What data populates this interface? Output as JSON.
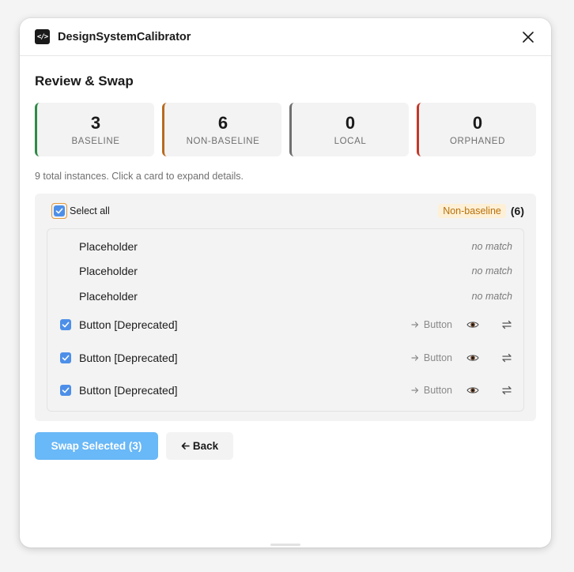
{
  "window": {
    "title": "DesignSystemCalibrator"
  },
  "heading": "Review & Swap",
  "stats": [
    {
      "count": "3",
      "label": "BASELINE",
      "color": "#2f8a46"
    },
    {
      "count": "6",
      "label": "NON-BASELINE",
      "color": "#b96a1e"
    },
    {
      "count": "0",
      "label": "LOCAL",
      "color": "#6f6f6f"
    },
    {
      "count": "0",
      "label": "ORPHANED",
      "color": "#c0392b"
    }
  ],
  "hint": "9 total instances. Click a card to expand details.",
  "group": {
    "select_all_label": "Select all",
    "select_all_checked": true,
    "tag": "Non-baseline",
    "count": "(6)",
    "rows": [
      {
        "name": "Placeholder",
        "status": "no match"
      },
      {
        "name": "Placeholder",
        "status": "no match"
      },
      {
        "name": "Placeholder",
        "status": "no match"
      },
      {
        "name": "Button [Deprecated]",
        "target": "Button",
        "checked": true
      },
      {
        "name": "Button [Deprecated]",
        "target": "Button",
        "checked": true
      },
      {
        "name": "Button [Deprecated]",
        "target": "Button",
        "checked": true
      }
    ]
  },
  "actions": {
    "swap_label": "Swap Selected (3)",
    "back_label": "Back"
  },
  "icons": {
    "arrow": "arrow-right-icon",
    "preview": "eye-icon",
    "swap": "swap-arrows-icon"
  }
}
